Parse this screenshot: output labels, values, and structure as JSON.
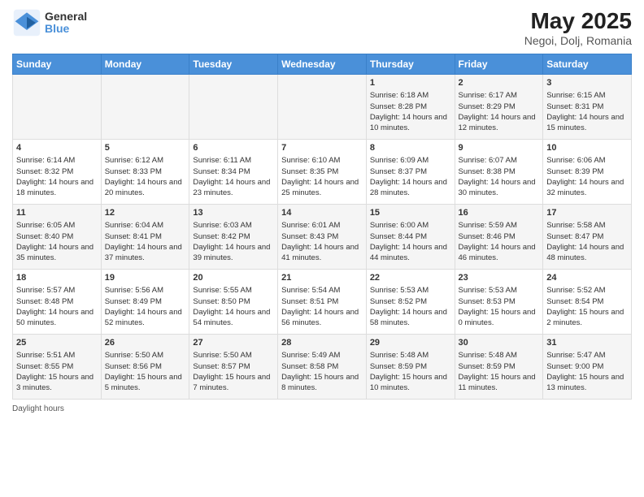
{
  "header": {
    "logo_line1": "General",
    "logo_line2": "Blue",
    "title": "May 2025",
    "subtitle": "Negoi, Dolj, Romania"
  },
  "days_of_week": [
    "Sunday",
    "Monday",
    "Tuesday",
    "Wednesday",
    "Thursday",
    "Friday",
    "Saturday"
  ],
  "legend": {
    "daylight_label": "Daylight hours"
  },
  "weeks": [
    [
      {
        "day": "",
        "content": ""
      },
      {
        "day": "",
        "content": ""
      },
      {
        "day": "",
        "content": ""
      },
      {
        "day": "",
        "content": ""
      },
      {
        "day": "1",
        "content": "Sunrise: 6:18 AM\nSunset: 8:28 PM\nDaylight: 14 hours and 10 minutes."
      },
      {
        "day": "2",
        "content": "Sunrise: 6:17 AM\nSunset: 8:29 PM\nDaylight: 14 hours and 12 minutes."
      },
      {
        "day": "3",
        "content": "Sunrise: 6:15 AM\nSunset: 8:31 PM\nDaylight: 14 hours and 15 minutes."
      }
    ],
    [
      {
        "day": "4",
        "content": "Sunrise: 6:14 AM\nSunset: 8:32 PM\nDaylight: 14 hours and 18 minutes."
      },
      {
        "day": "5",
        "content": "Sunrise: 6:12 AM\nSunset: 8:33 PM\nDaylight: 14 hours and 20 minutes."
      },
      {
        "day": "6",
        "content": "Sunrise: 6:11 AM\nSunset: 8:34 PM\nDaylight: 14 hours and 23 minutes."
      },
      {
        "day": "7",
        "content": "Sunrise: 6:10 AM\nSunset: 8:35 PM\nDaylight: 14 hours and 25 minutes."
      },
      {
        "day": "8",
        "content": "Sunrise: 6:09 AM\nSunset: 8:37 PM\nDaylight: 14 hours and 28 minutes."
      },
      {
        "day": "9",
        "content": "Sunrise: 6:07 AM\nSunset: 8:38 PM\nDaylight: 14 hours and 30 minutes."
      },
      {
        "day": "10",
        "content": "Sunrise: 6:06 AM\nSunset: 8:39 PM\nDaylight: 14 hours and 32 minutes."
      }
    ],
    [
      {
        "day": "11",
        "content": "Sunrise: 6:05 AM\nSunset: 8:40 PM\nDaylight: 14 hours and 35 minutes."
      },
      {
        "day": "12",
        "content": "Sunrise: 6:04 AM\nSunset: 8:41 PM\nDaylight: 14 hours and 37 minutes."
      },
      {
        "day": "13",
        "content": "Sunrise: 6:03 AM\nSunset: 8:42 PM\nDaylight: 14 hours and 39 minutes."
      },
      {
        "day": "14",
        "content": "Sunrise: 6:01 AM\nSunset: 8:43 PM\nDaylight: 14 hours and 41 minutes."
      },
      {
        "day": "15",
        "content": "Sunrise: 6:00 AM\nSunset: 8:44 PM\nDaylight: 14 hours and 44 minutes."
      },
      {
        "day": "16",
        "content": "Sunrise: 5:59 AM\nSunset: 8:46 PM\nDaylight: 14 hours and 46 minutes."
      },
      {
        "day": "17",
        "content": "Sunrise: 5:58 AM\nSunset: 8:47 PM\nDaylight: 14 hours and 48 minutes."
      }
    ],
    [
      {
        "day": "18",
        "content": "Sunrise: 5:57 AM\nSunset: 8:48 PM\nDaylight: 14 hours and 50 minutes."
      },
      {
        "day": "19",
        "content": "Sunrise: 5:56 AM\nSunset: 8:49 PM\nDaylight: 14 hours and 52 minutes."
      },
      {
        "day": "20",
        "content": "Sunrise: 5:55 AM\nSunset: 8:50 PM\nDaylight: 14 hours and 54 minutes."
      },
      {
        "day": "21",
        "content": "Sunrise: 5:54 AM\nSunset: 8:51 PM\nDaylight: 14 hours and 56 minutes."
      },
      {
        "day": "22",
        "content": "Sunrise: 5:53 AM\nSunset: 8:52 PM\nDaylight: 14 hours and 58 minutes."
      },
      {
        "day": "23",
        "content": "Sunrise: 5:53 AM\nSunset: 8:53 PM\nDaylight: 15 hours and 0 minutes."
      },
      {
        "day": "24",
        "content": "Sunrise: 5:52 AM\nSunset: 8:54 PM\nDaylight: 15 hours and 2 minutes."
      }
    ],
    [
      {
        "day": "25",
        "content": "Sunrise: 5:51 AM\nSunset: 8:55 PM\nDaylight: 15 hours and 3 minutes."
      },
      {
        "day": "26",
        "content": "Sunrise: 5:50 AM\nSunset: 8:56 PM\nDaylight: 15 hours and 5 minutes."
      },
      {
        "day": "27",
        "content": "Sunrise: 5:50 AM\nSunset: 8:57 PM\nDaylight: 15 hours and 7 minutes."
      },
      {
        "day": "28",
        "content": "Sunrise: 5:49 AM\nSunset: 8:58 PM\nDaylight: 15 hours and 8 minutes."
      },
      {
        "day": "29",
        "content": "Sunrise: 5:48 AM\nSunset: 8:59 PM\nDaylight: 15 hours and 10 minutes."
      },
      {
        "day": "30",
        "content": "Sunrise: 5:48 AM\nSunset: 8:59 PM\nDaylight: 15 hours and 11 minutes."
      },
      {
        "day": "31",
        "content": "Sunrise: 5:47 AM\nSunset: 9:00 PM\nDaylight: 15 hours and 13 minutes."
      }
    ]
  ]
}
